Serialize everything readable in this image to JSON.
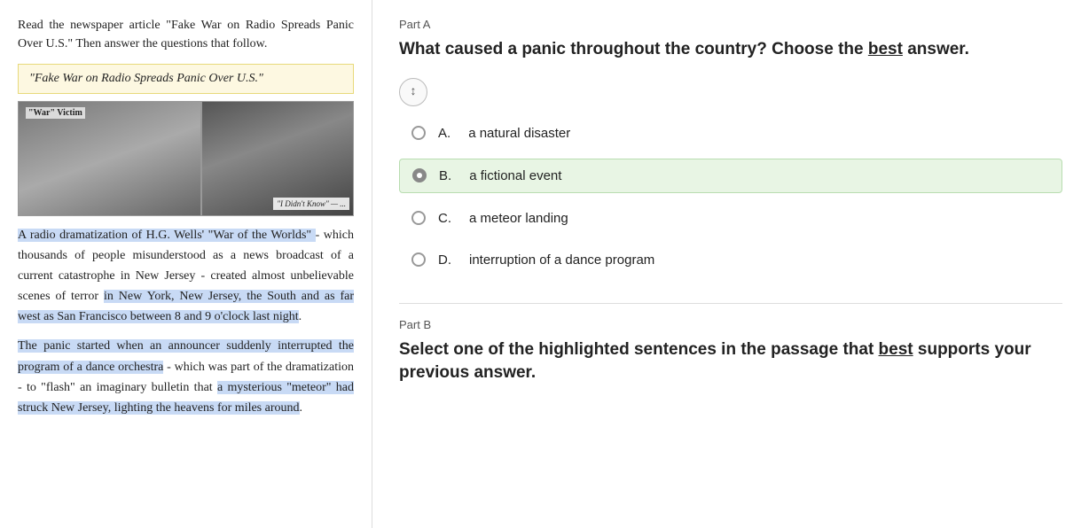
{
  "left": {
    "instructions": "Read the newspaper article \"Fake War on Radio Spreads Panic Over U.S.\" Then answer the questions that follow.",
    "article_title": "\"Fake War on Radio Spreads Panic Over U.S.\"",
    "war_victim_label": "\"War\" Victim",
    "caption": "\"I Didn't Know\" — ...",
    "paragraph1_plain1": "A radio dramatization of H.G. Wells' \"War of the Worlds\"",
    "paragraph1_plain2": " - which thousands of people misunderstood as a news broadcast of a current catastrophe in New Jersey - created almost unbelievable scenes of terror ",
    "paragraph1_highlight": "in New York, New Jersey, the South and as far west as San Francisco between 8 and 9 o'clock last night",
    "paragraph1_end": ".",
    "paragraph2_highlight": "The panic started when an announcer suddenly interrupted the program of a dance orchestra",
    "paragraph2_rest": " - which was part of the dramatization - to \"flash\" an imaginary bulletin that ",
    "paragraph2_inline_highlight": "a mysterious \"meteor\" had struck New Jersey, lighting the heavens for miles around",
    "paragraph2_end": "."
  },
  "right": {
    "part_a_label": "Part A",
    "question": "What caused a panic throughout the country? Choose the best answer.",
    "question_underline_word": "best",
    "scroll_icon": "↕",
    "options": [
      {
        "letter": "A.",
        "text": "a natural disaster",
        "selected": false
      },
      {
        "letter": "B.",
        "text": "a fictional event",
        "selected": true
      },
      {
        "letter": "C.",
        "text": "a meteor landing",
        "selected": false
      },
      {
        "letter": "D.",
        "text": "interruption of a dance program",
        "selected": false
      }
    ],
    "part_b_label": "Part B",
    "part_b_question": "Select one of the highlighted sentences in the passage that best supports your previous answer.",
    "part_b_underline_word": "best"
  }
}
